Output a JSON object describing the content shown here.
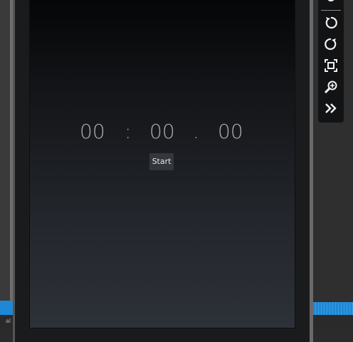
{
  "stopwatch": {
    "minutes": "00",
    "separator_1": ":",
    "seconds": "00",
    "separator_2": ".",
    "hundredths": "00",
    "start_label": "Start"
  },
  "toolbar": {
    "tools": [
      "touch-icon",
      "rotate-left-icon",
      "rotate-right-icon",
      "screenshot-icon",
      "zoom-icon",
      "more-icon"
    ]
  },
  "status_bar": {
    "left_text": "al"
  },
  "colors": {
    "accent": "#1e88d6",
    "screen_top": "#050607",
    "screen_bottom": "#2d3138",
    "digits": "#a9abae"
  }
}
